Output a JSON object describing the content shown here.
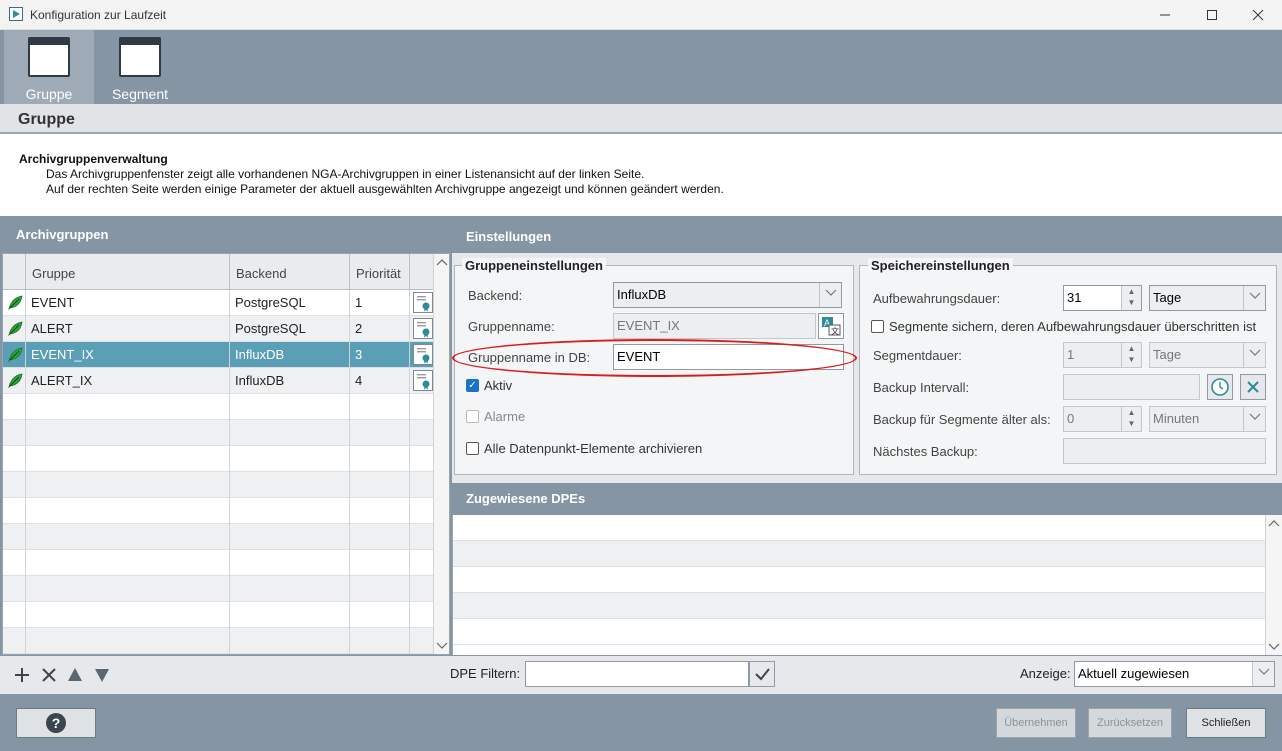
{
  "window": {
    "title": "Konfiguration zur Laufzeit"
  },
  "toolbar": {
    "items": [
      {
        "label": "Gruppe"
      },
      {
        "label": "Segment"
      }
    ]
  },
  "section": {
    "title": "Gruppe"
  },
  "description": {
    "title": "Archivgruppenverwaltung",
    "line1": "Das Archivgruppenfenster zeigt alle vorhandenen NGA-Archivgruppen in einer Listenansicht auf der linken Seite.",
    "line2": "Auf der rechten Seite werden einige Parameter der aktuell ausgewählten Archivgruppe angezeigt und können geändert werden."
  },
  "archive_groups": {
    "title": "Archivgruppen",
    "columns": [
      "Gruppe",
      "Backend",
      "Priorität"
    ],
    "rows": [
      {
        "group": "EVENT",
        "backend": "PostgreSQL",
        "priority": "1"
      },
      {
        "group": "ALERT",
        "backend": "PostgreSQL",
        "priority": "2"
      },
      {
        "group": "EVENT_IX",
        "backend": "InfluxDB",
        "priority": "3"
      },
      {
        "group": "ALERT_IX",
        "backend": "InfluxDB",
        "priority": "4"
      }
    ],
    "selected_index": 2
  },
  "settings": {
    "title": "Einstellungen",
    "group_settings": {
      "title": "Gruppeneinstellungen",
      "backend_label": "Backend:",
      "backend_value": "InfluxDB",
      "group_name_label": "Gruppenname:",
      "group_name_value": "EVENT_IX",
      "db_name_label": "Gruppenname in DB:",
      "db_name_value": "EVENT",
      "active_label": "Aktiv",
      "active_checked": true,
      "alarms_label": "Alarme",
      "archive_all_label": "Alle Datenpunkt-Elemente archivieren"
    },
    "storage_settings": {
      "title": "Speichereinstellungen",
      "retention_label": "Aufbewahrungsdauer:",
      "retention_value": "31",
      "retention_unit": "Tage",
      "backup_expired_label": "Segmente sichern, deren Aufbewahrungsdauer überschritten ist",
      "segment_duration_label": "Segmentdauer:",
      "segment_duration_value": "1",
      "segment_duration_unit": "Tage",
      "backup_interval_label": "Backup Intervall:",
      "backup_interval_value": "",
      "backup_older_label": "Backup für Segmente älter als:",
      "backup_older_value": "0",
      "backup_older_unit": "Minuten",
      "next_backup_label": "Nächstes Backup:",
      "next_backup_value": ""
    }
  },
  "assigned_dpes": {
    "title": "Zugewiesene DPEs"
  },
  "bottom": {
    "filter_label": "DPE Filtern:",
    "filter_value": "",
    "display_label": "Anzeige:",
    "display_value": "Aktuell zugewiesen"
  },
  "footer": {
    "help_label": "?",
    "apply_label": "Übernehmen",
    "reset_label": "Zurücksetzen",
    "close_label": "Schließen"
  },
  "colors": {
    "toolbar_bg": "#8595a3",
    "selection": "#5b9fb6",
    "highlight_ellipse": "#d91d1d",
    "active_checkbox": "#1a73c8"
  }
}
